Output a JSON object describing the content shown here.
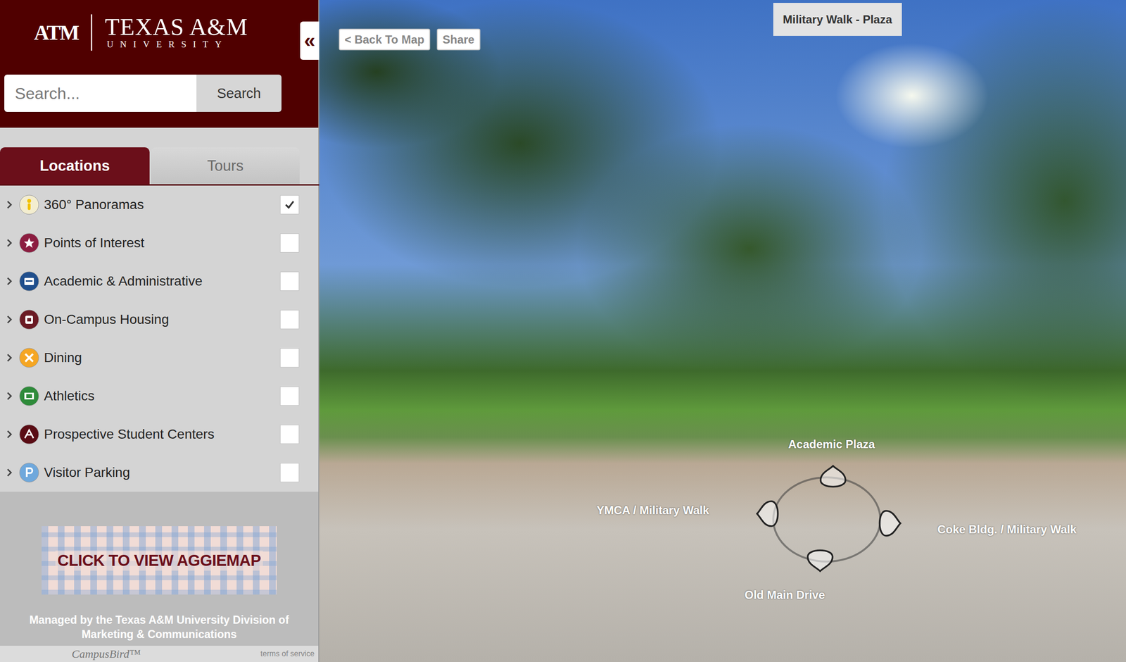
{
  "logo": {
    "mark": "ATM",
    "title": "TEXAS A&M",
    "subtitle": "UNIVERSITY"
  },
  "collapse_button": "«",
  "search": {
    "placeholder": "Search...",
    "button": "Search"
  },
  "tabs": [
    {
      "label": "Locations",
      "selected": true
    },
    {
      "label": "Tours",
      "selected": false
    }
  ],
  "categories": [
    {
      "label": "360° Panoramas",
      "checked": true,
      "color": "#f3edcf"
    },
    {
      "label": "Points of Interest",
      "checked": false,
      "color": "#8c1d40"
    },
    {
      "label": "Academic & Administrative",
      "checked": false,
      "color": "#1f4e8c"
    },
    {
      "label": "On-Campus Housing",
      "checked": false,
      "color": "#6b1a24"
    },
    {
      "label": "Dining",
      "checked": false,
      "color": "#f5a623"
    },
    {
      "label": "Athletics",
      "checked": false,
      "color": "#2e8b3a"
    },
    {
      "label": "Prospective Student Centers",
      "checked": false,
      "color": "#5a0c14"
    },
    {
      "label": "Visitor Parking",
      "checked": false,
      "color": "#6fa8dc"
    }
  ],
  "map_banner": "CLICK TO VIEW AGGIEMAP",
  "footer": {
    "managed_by": "Managed by the Texas A&M University Division of Marketing & Communications",
    "brand": "CampusBird™",
    "terms": "terms of service"
  },
  "viewer": {
    "back_button": "< Back To Map",
    "share_button": "Share",
    "title": "Military Walk - Plaza",
    "hotspots": [
      {
        "label": "Academic Plaza"
      },
      {
        "label": "YMCA / Military Walk"
      },
      {
        "label": "Coke Bldg. / Military Walk"
      },
      {
        "label": "Old Main Drive"
      }
    ]
  }
}
